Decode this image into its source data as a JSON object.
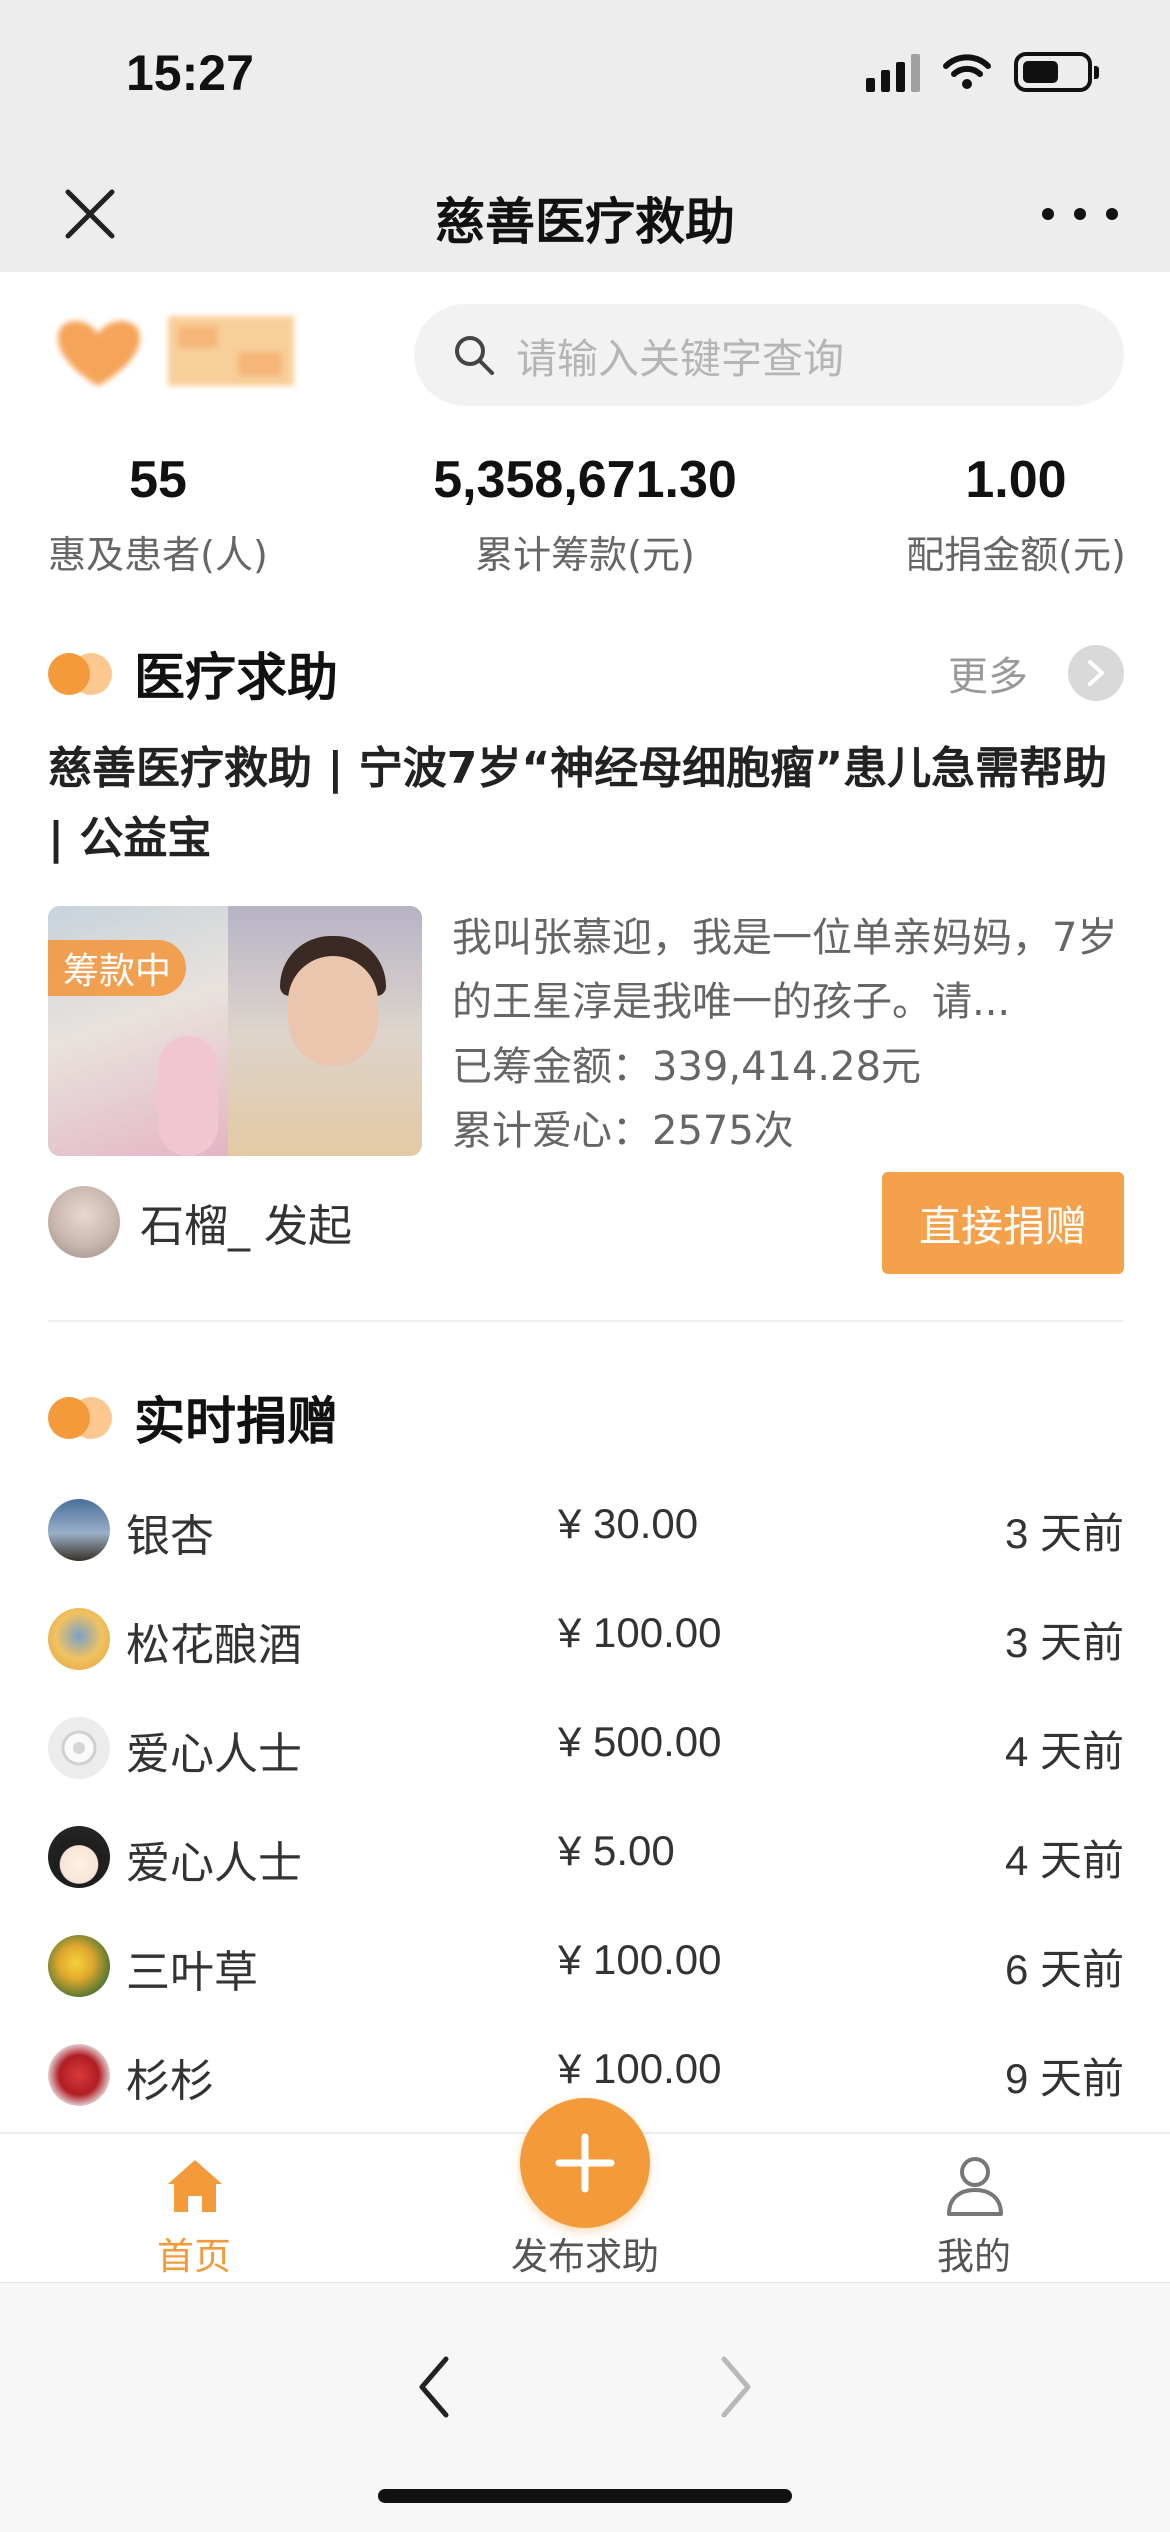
{
  "status_bar": {
    "time": "15:27"
  },
  "nav": {
    "title": "慈善医疗救助"
  },
  "search": {
    "placeholder": "请输入关键字查询"
  },
  "stats": [
    {
      "value": "55",
      "label": "惠及患者(人)"
    },
    {
      "value": "5,358,671.30",
      "label": "累计筹款(元)"
    },
    {
      "value": "1.00",
      "label": "配捐金额(元)"
    }
  ],
  "medical_section": {
    "title": "医疗求助",
    "more_label": "更多",
    "case": {
      "title": "慈善医疗救助 | 宁波7岁“神经母细胞瘤”患儿急需帮助 | 公益宝",
      "status_badge": "筹款中",
      "description": "我叫张慕迎，我是一位单亲妈妈，7岁的王星淳是我唯一的孩子。请...",
      "raised_label": "已筹金额：",
      "raised_amount": "339,414.28元",
      "love_label": "累计爱心：",
      "love_count": "2575次",
      "initiator": "石榴_ 发起",
      "donate_label": "直接捐赠"
    }
  },
  "realtime_section": {
    "title": "实时捐赠",
    "donations": [
      {
        "name": "银杏",
        "amount": "¥ 30.00",
        "time": "3 天前"
      },
      {
        "name": "松花酿酒",
        "amount": "¥ 100.00",
        "time": "3 天前"
      },
      {
        "name": "爱心人士",
        "amount": "¥ 500.00",
        "time": "4 天前"
      },
      {
        "name": "爱心人士",
        "amount": "¥ 5.00",
        "time": "4 天前"
      },
      {
        "name": "三叶草",
        "amount": "¥ 100.00",
        "time": "6 天前"
      },
      {
        "name": "杉杉",
        "amount": "¥ 100.00",
        "time": "9 天前"
      }
    ]
  },
  "tabbar": {
    "home": "首页",
    "publish": "发布求助",
    "mine": "我的",
    "active_color": "#f39a3a",
    "inactive_color": "#555555"
  },
  "accent_color": "#f39a3a"
}
